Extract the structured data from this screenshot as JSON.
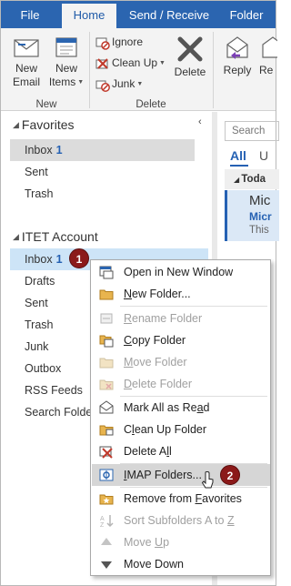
{
  "tabs": {
    "file": "File",
    "home": "Home",
    "send_receive": "Send / Receive",
    "folder": "Folder"
  },
  "ribbon": {
    "new_email_line1": "New",
    "new_email_line2": "Email",
    "new_items_line1": "New",
    "new_items_line2": "Items",
    "group_new": "New",
    "ignore": "Ignore",
    "clean_up": "Clean Up",
    "junk": "Junk",
    "delete": "Delete",
    "group_delete": "Delete",
    "reply": "Reply",
    "reply_all_partial": "Re"
  },
  "nav": {
    "favorites_header": "Favorites",
    "favorites": [
      {
        "label": "Inbox",
        "count": "1"
      },
      {
        "label": "Sent"
      },
      {
        "label": "Trash"
      }
    ],
    "account_header": "ITET Account",
    "account_folders": [
      {
        "label": "Inbox",
        "count": "1"
      },
      {
        "label": "Drafts"
      },
      {
        "label": "Sent"
      },
      {
        "label": "Trash"
      },
      {
        "label": "Junk"
      },
      {
        "label": "Outbox"
      },
      {
        "label": "RSS Feeds"
      },
      {
        "label": "Search Folders"
      }
    ],
    "collapse_glyph": "‹"
  },
  "message_list": {
    "search_placeholder": "Search",
    "all_tab": "All",
    "unread_tab_partial": "U",
    "group_today_partial": "Toda",
    "item_from_partial": "Mic",
    "item_subject_partial": "Micr",
    "item_preview_partial": "This"
  },
  "badges": {
    "step1": "1",
    "step2": "2"
  },
  "context_menu": {
    "items": [
      {
        "pre": "Open in New Window",
        "u": "",
        "post": "",
        "disabled": false
      },
      {
        "pre": "",
        "u": "N",
        "post": "ew Folder...",
        "disabled": false
      },
      {
        "pre": "",
        "u": "R",
        "post": "ename Folder",
        "disabled": true
      },
      {
        "pre": "",
        "u": "C",
        "post": "opy Folder",
        "disabled": false
      },
      {
        "pre": "",
        "u": "M",
        "post": "ove Folder",
        "disabled": true
      },
      {
        "pre": "",
        "u": "D",
        "post": "elete Folder",
        "disabled": true
      },
      {
        "pre": "Mark All as Re",
        "u": "a",
        "post": "d",
        "disabled": false
      },
      {
        "pre": "C",
        "u": "l",
        "post": "ean Up Folder",
        "disabled": false
      },
      {
        "pre": "Delete A",
        "u": "l",
        "post": "l",
        "disabled": false
      },
      {
        "pre": "",
        "u": "I",
        "post": "MAP Folders...",
        "disabled": false
      },
      {
        "pre": "Remove from ",
        "u": "F",
        "post": "avorites",
        "disabled": false
      },
      {
        "pre": "Sort Subfolders A to ",
        "u": "Z",
        "post": "",
        "disabled": true
      },
      {
        "pre": "Move ",
        "u": "U",
        "post": "p",
        "disabled": true
      },
      {
        "pre": "Move Down",
        "u": "",
        "post": "",
        "disabled": false
      }
    ]
  },
  "colors": {
    "accent": "#2b65b0",
    "badge": "#8b1a1a",
    "selection": "#cde4f7"
  }
}
